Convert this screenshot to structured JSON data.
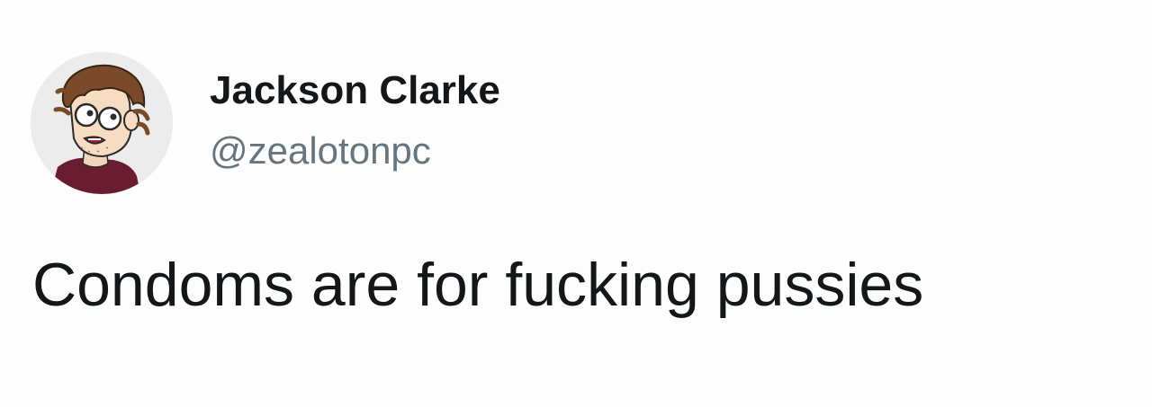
{
  "tweet": {
    "author": {
      "display_name": "Jackson Clarke",
      "handle": "@zealotonpc",
      "avatar_icon": "cartoon-avatar"
    },
    "text": "Condoms are for fucking pussies"
  },
  "colors": {
    "background": "#fdfdfd",
    "name": "#14171a",
    "handle": "#66757f",
    "text": "#14171a"
  }
}
